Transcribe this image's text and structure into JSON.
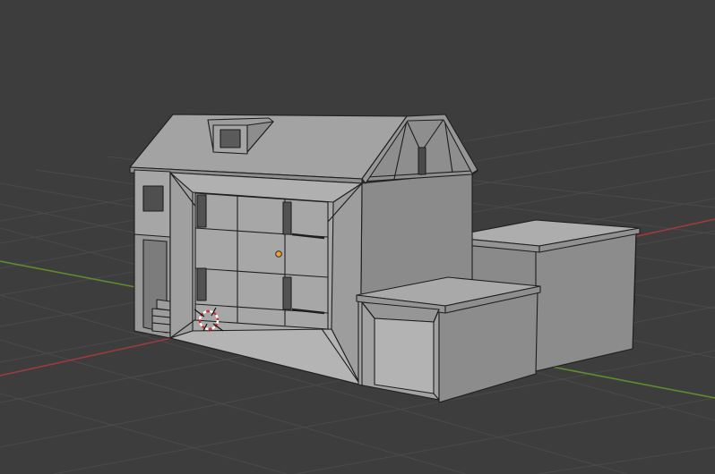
{
  "viewport": {
    "background": "#3d3d3d",
    "grid_color": "#4a4a4a",
    "x_axis_color": "#9a3b3f",
    "y_axis_color": "#5f8a2f",
    "origin_color": "#f0a030",
    "cursor_colors": [
      "#d03030",
      "#ffffff"
    ],
    "model_color": "#9a9a9a",
    "edge_color": "#1e1e1e"
  },
  "icons": {
    "origin": "object-origin-dot",
    "cursor": "3d-cursor-icon"
  }
}
